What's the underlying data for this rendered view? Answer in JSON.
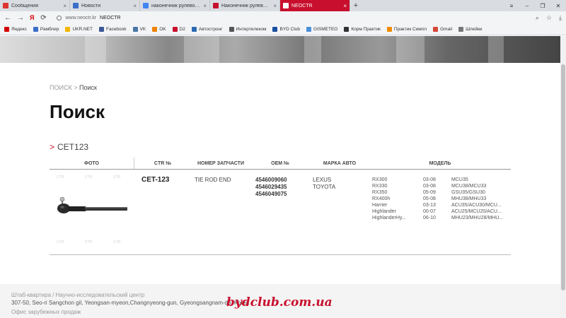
{
  "browser": {
    "tabs": [
      {
        "label": "Сообщения",
        "color": "#d33",
        "active": false
      },
      {
        "label": "Новости",
        "color": "#3b6fc9",
        "active": false
      },
      {
        "label": "наконечник рулевой CTR",
        "color": "#4285f4",
        "active": false
      },
      {
        "label": "Наконечник рулевой CTR",
        "color": "#c8102e",
        "active": false
      },
      {
        "label": "NEOCTR",
        "color": "#ffffff",
        "active": true
      }
    ],
    "new_tab_label": "+",
    "address": {
      "host": "www.neoctr.kr",
      "title": "NEOCTR"
    },
    "bookmarks": [
      {
        "label": "Яндекс",
        "color": "#d40000"
      },
      {
        "label": "Рамблер",
        "color": "#3b6fc9"
      },
      {
        "label": "UKR.NET",
        "color": "#f2b600"
      },
      {
        "label": "Facebook",
        "color": "#3b5998"
      },
      {
        "label": "VK",
        "color": "#4a76a8"
      },
      {
        "label": "OK",
        "color": "#ee8208"
      },
      {
        "label": "D2",
        "color": "#c8102e"
      },
      {
        "label": "Автостронг",
        "color": "#2a6ab3"
      },
      {
        "label": "Интертелеком",
        "color": "#555555"
      },
      {
        "label": "BYD Club",
        "color": "#1a4fa0"
      },
      {
        "label": "GISMETEO",
        "color": "#4a90d9"
      },
      {
        "label": "Корм Практик",
        "color": "#333333"
      },
      {
        "label": "Практик Симпл",
        "color": "#f08a00"
      },
      {
        "label": "Gmail",
        "color": "#d44638"
      },
      {
        "label": "Шлейки",
        "color": "#777777"
      }
    ]
  },
  "page": {
    "breadcrumb": {
      "root": "ПОИСК",
      "separator": ">",
      "current": "Поиск"
    },
    "title": "Поиск",
    "query": {
      "marker": ">",
      "text": "CET123"
    },
    "table": {
      "headers": {
        "photo": "ФОТО",
        "ctr": "CTR №",
        "part": "НОМЕР ЗАПЧАСТИ",
        "oem": "OEM №",
        "make": "МАРКА АВТО",
        "model": "МОДЕЛЬ"
      },
      "row": {
        "ctr": "CET-123",
        "part": "TIE ROD END",
        "oem": [
          "4546009060",
          "4546029435",
          "4546049075"
        ],
        "make": [
          "LEXUS",
          "TOYOTA"
        ],
        "models": [
          {
            "name": "RX300",
            "years": "03-08",
            "code": "MCU35"
          },
          {
            "name": "RX330",
            "years": "03-08",
            "code": "MCU38/MCU33"
          },
          {
            "name": "RX350",
            "years": "05-09",
            "code": "GSU35/GSU30"
          },
          {
            "name": "RX400h",
            "years": "05-08",
            "code": "MHU38/MHU33"
          },
          {
            "name": "Harrier",
            "years": "03-13",
            "code": "ACU35/ACU30/MCU..."
          },
          {
            "name": "Highlander",
            "years": "00-07",
            "code": "ACU25/MCU20/ACU..."
          },
          {
            "name": "HighlanderHy...",
            "years": "06-10",
            "code": "MHU23/MHU28/MHU..."
          }
        ]
      }
    },
    "watermark_label": "CTR"
  },
  "footer": {
    "hq_title": "Штаб-квартира / Научно-исследовательский центр",
    "hq_address": "307-50, Seo-ri Sangchon gil, Yeongsan-myeon,Changnyeong-gun, Gyeongsangnam-do, Korea",
    "overseas_title": "Офис зарубежных продаж",
    "overlay_watermark": "bydclub.com.ua"
  }
}
